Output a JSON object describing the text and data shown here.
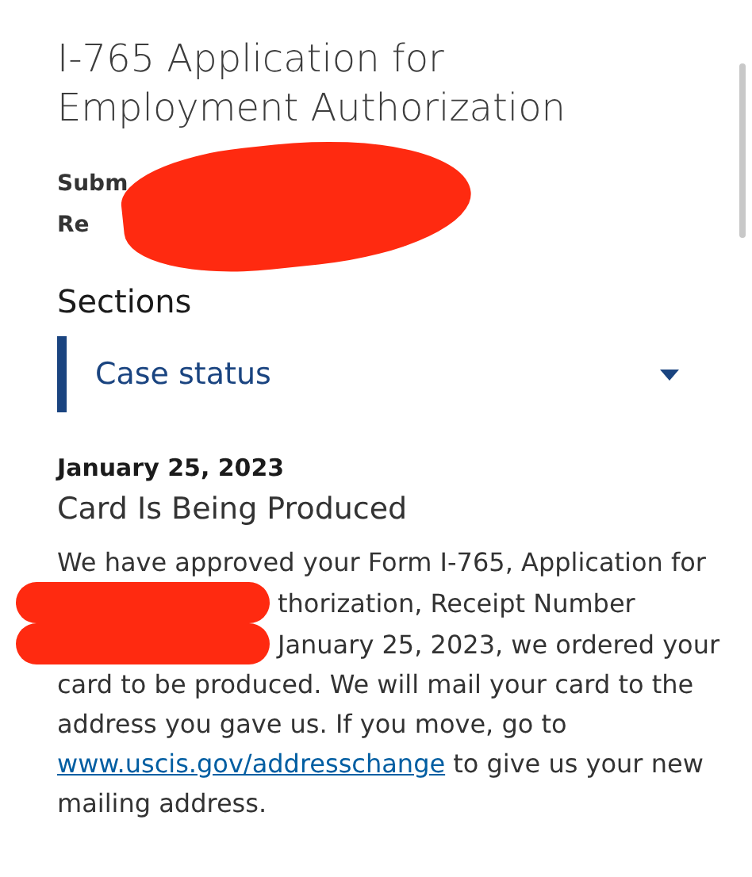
{
  "page_title": "I-765 Application for Employment Authorization",
  "details": [
    {
      "label": "Subm"
    },
    {
      "label": "Re"
    }
  ],
  "sections": {
    "heading": "Sections",
    "accordion": {
      "label": "Case status",
      "expanded": true
    }
  },
  "case_status": {
    "date": "January 25, 2023",
    "status": "Card Is Being Produced",
    "lines": [
      {
        "text": "We have approved your Form I-765, Application for",
        "redacted": false
      },
      {
        "text": "thorization, Receipt Number",
        "redacted": true
      },
      {
        "text": "January 25, 2023, we ordered your",
        "redacted": true
      },
      {
        "text": "card to be produced. We will mail your card to the",
        "redacted": false
      },
      {
        "text": "address you gave us. If you move, go to",
        "redacted": false
      }
    ],
    "link": "www.uscis.gov/addresschange",
    "after_link": "to give us your new",
    "last_line": "mailing address."
  }
}
